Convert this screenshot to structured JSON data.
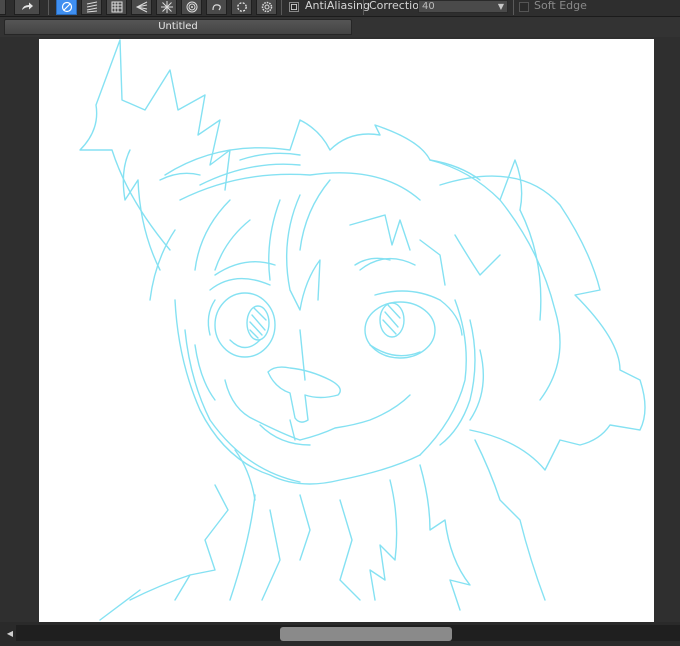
{
  "toolbar": {
    "antialiasing_label": "AntiAliasing",
    "antialiasing_checked": true,
    "correction_label": "Correction",
    "correction_value": "40",
    "soft_edge_label": "Soft Edge",
    "soft_edge_checked": false
  },
  "document": {
    "tab_title": "Untitled"
  },
  "icons": [
    "redo-icon",
    "pen-icon",
    "hatch-icon",
    "grid-icon",
    "perspective-icon",
    "radial-icon",
    "concentric-icon",
    "curve-icon",
    "ellipse-icon",
    "settings-icon"
  ],
  "colors": {
    "active_tool": "#3f8ff0",
    "sketch_stroke": "#7fe0f2",
    "canvas": "#ffffff"
  }
}
